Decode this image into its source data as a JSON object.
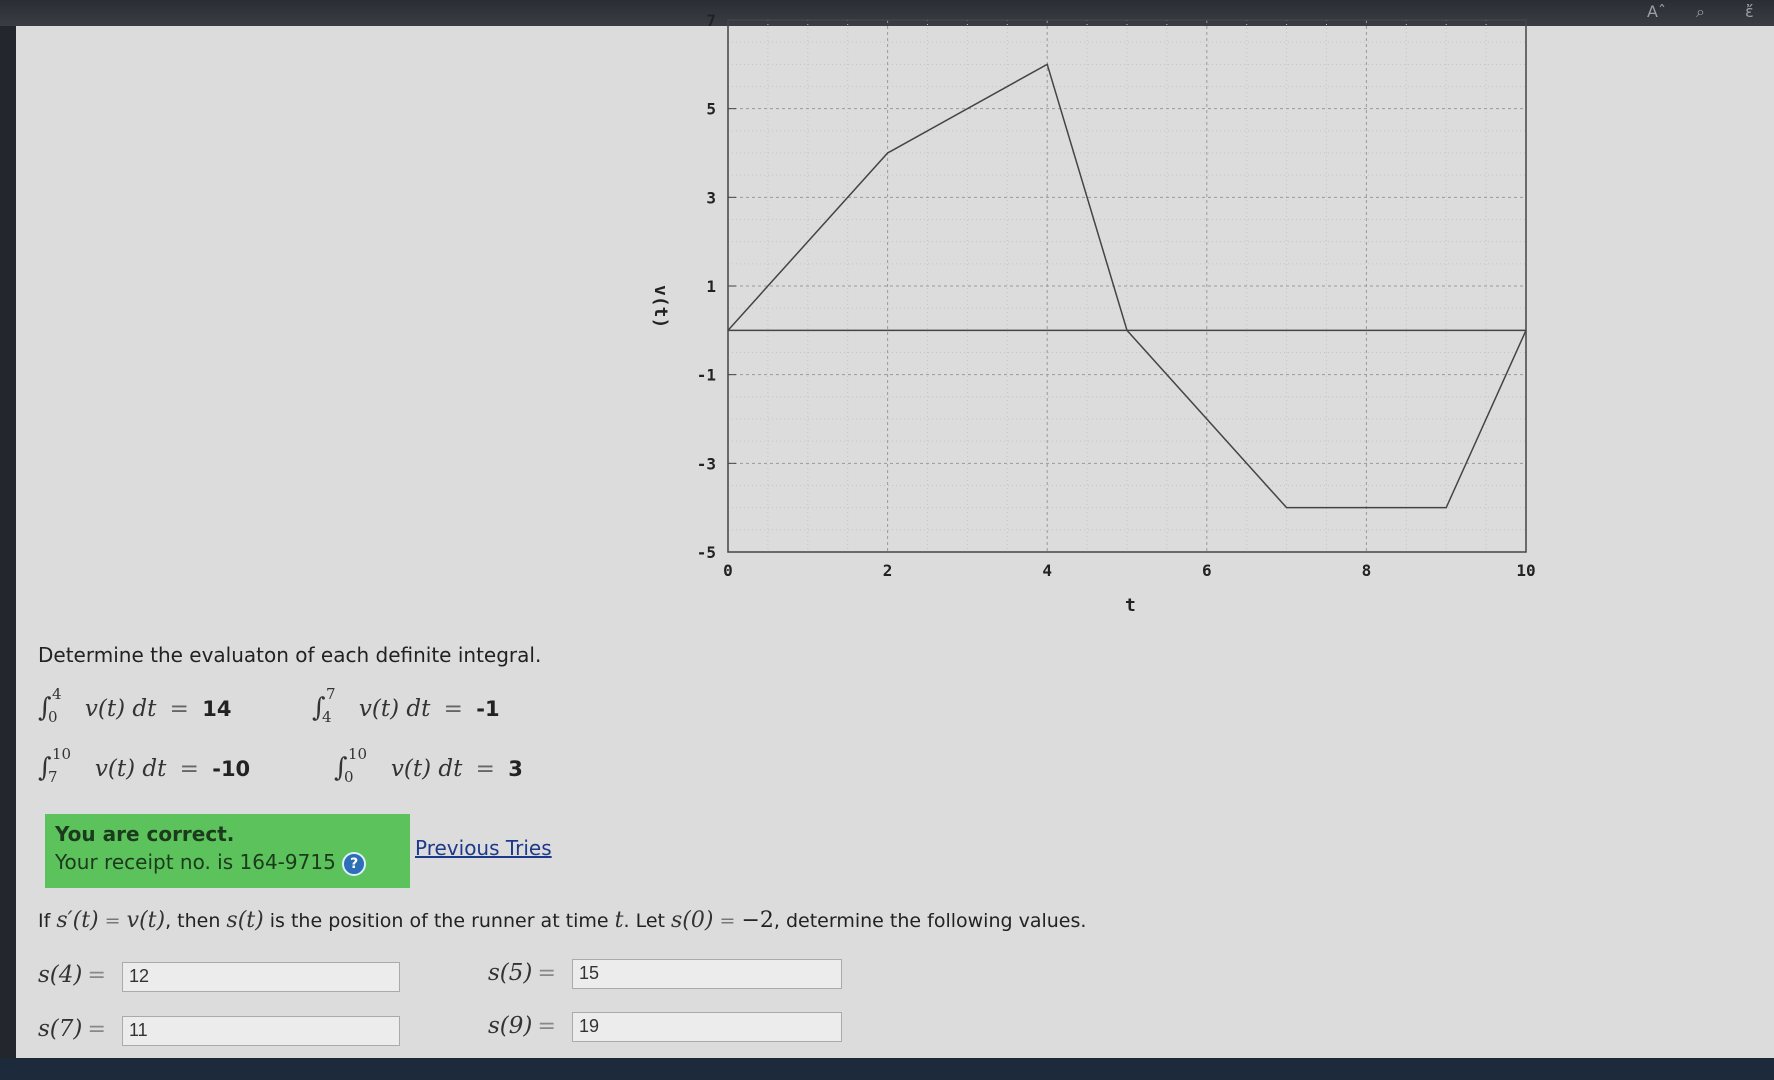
{
  "topbar": {
    "icons": [
      "font-size-icon",
      "zoom-icon",
      "read-aloud-icon"
    ],
    "glyphs": [
      "Aˆ",
      "⌕",
      "ἔ"
    ]
  },
  "chart_data": {
    "type": "line",
    "xlabel": "t",
    "ylabel": "v(t)",
    "xticks": [
      "0",
      "2",
      "4",
      "6",
      "8",
      "10"
    ],
    "yticks": [
      "7",
      "5",
      "3",
      "1",
      "-1",
      "-3",
      "-5"
    ],
    "xlim": [
      0,
      10
    ],
    "ylim": [
      -5,
      7
    ],
    "grid": true,
    "series": [
      {
        "x": [
          0,
          2,
          4,
          5,
          7,
          9,
          10
        ],
        "y": [
          0,
          4,
          6,
          0,
          -4,
          -4,
          0
        ]
      }
    ]
  },
  "integrals": {
    "instructions": "Determine the evaluaton of each definite integral.",
    "items": [
      {
        "lower": "0",
        "upper": "4",
        "integrand": "v(t) dt",
        "eq": "=",
        "value": "14"
      },
      {
        "lower": "4",
        "upper": "7",
        "integrand": "v(t) dt",
        "eq": "=",
        "value": "-1"
      },
      {
        "lower": "7",
        "upper": "10",
        "integrand": "v(t) dt",
        "eq": "=",
        "value": "-10"
      },
      {
        "lower": "0",
        "upper": "10",
        "integrand": "v(t) dt",
        "eq": "=",
        "value": "3"
      }
    ]
  },
  "feedback": {
    "status": "You are correct.",
    "receipt": "Your receipt no. is 164-9715",
    "help_glyph": "?",
    "previous_tries": "Previous Tries"
  },
  "position": {
    "p_if": "If ",
    "p_sprime": "s′(t)",
    "p_eq1": " = ",
    "p_vt": "v(t)",
    "p_then": ", then ",
    "p_st": "s(t)",
    "p_mid": " is the position of the runner at time ",
    "p_t": "t",
    "p_let": ". Let ",
    "p_s0": "s(0)",
    "p_eq2": " = ",
    "p_neg2": "−2",
    "p_end": ", determine the following values.",
    "fields": [
      {
        "label": "s(4)",
        "eq": "=",
        "value": "12"
      },
      {
        "label": "s(5)",
        "eq": "=",
        "value": "15"
      },
      {
        "label": "s(7)",
        "eq": "=",
        "value": "11"
      },
      {
        "label": "s(9)",
        "eq": "=",
        "value": "19"
      }
    ]
  }
}
